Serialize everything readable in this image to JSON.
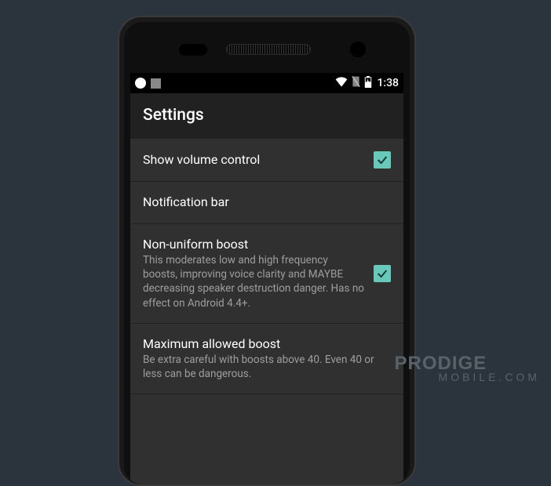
{
  "statusBar": {
    "time": "1:38"
  },
  "header": {
    "title": "Settings"
  },
  "rows": {
    "r0": {
      "title": "Show volume control",
      "subtitle": ""
    },
    "r1": {
      "title": "Notification bar",
      "subtitle": ""
    },
    "r2": {
      "title": "Non-uniform boost",
      "subtitle": "This moderates low and high frequency boosts, improving voice clarity and MAYBE decreasing speaker destruction danger. Has no effect on Android 4.4+."
    },
    "r3": {
      "title": "Maximum allowed boost",
      "subtitle": "Be extra careful with boosts above 40. Even 40 or less can be dangerous."
    }
  },
  "accentColor": "#68c9bb",
  "watermark": {
    "line1": "PRODIGE",
    "line2": "MOBILE.COM"
  }
}
